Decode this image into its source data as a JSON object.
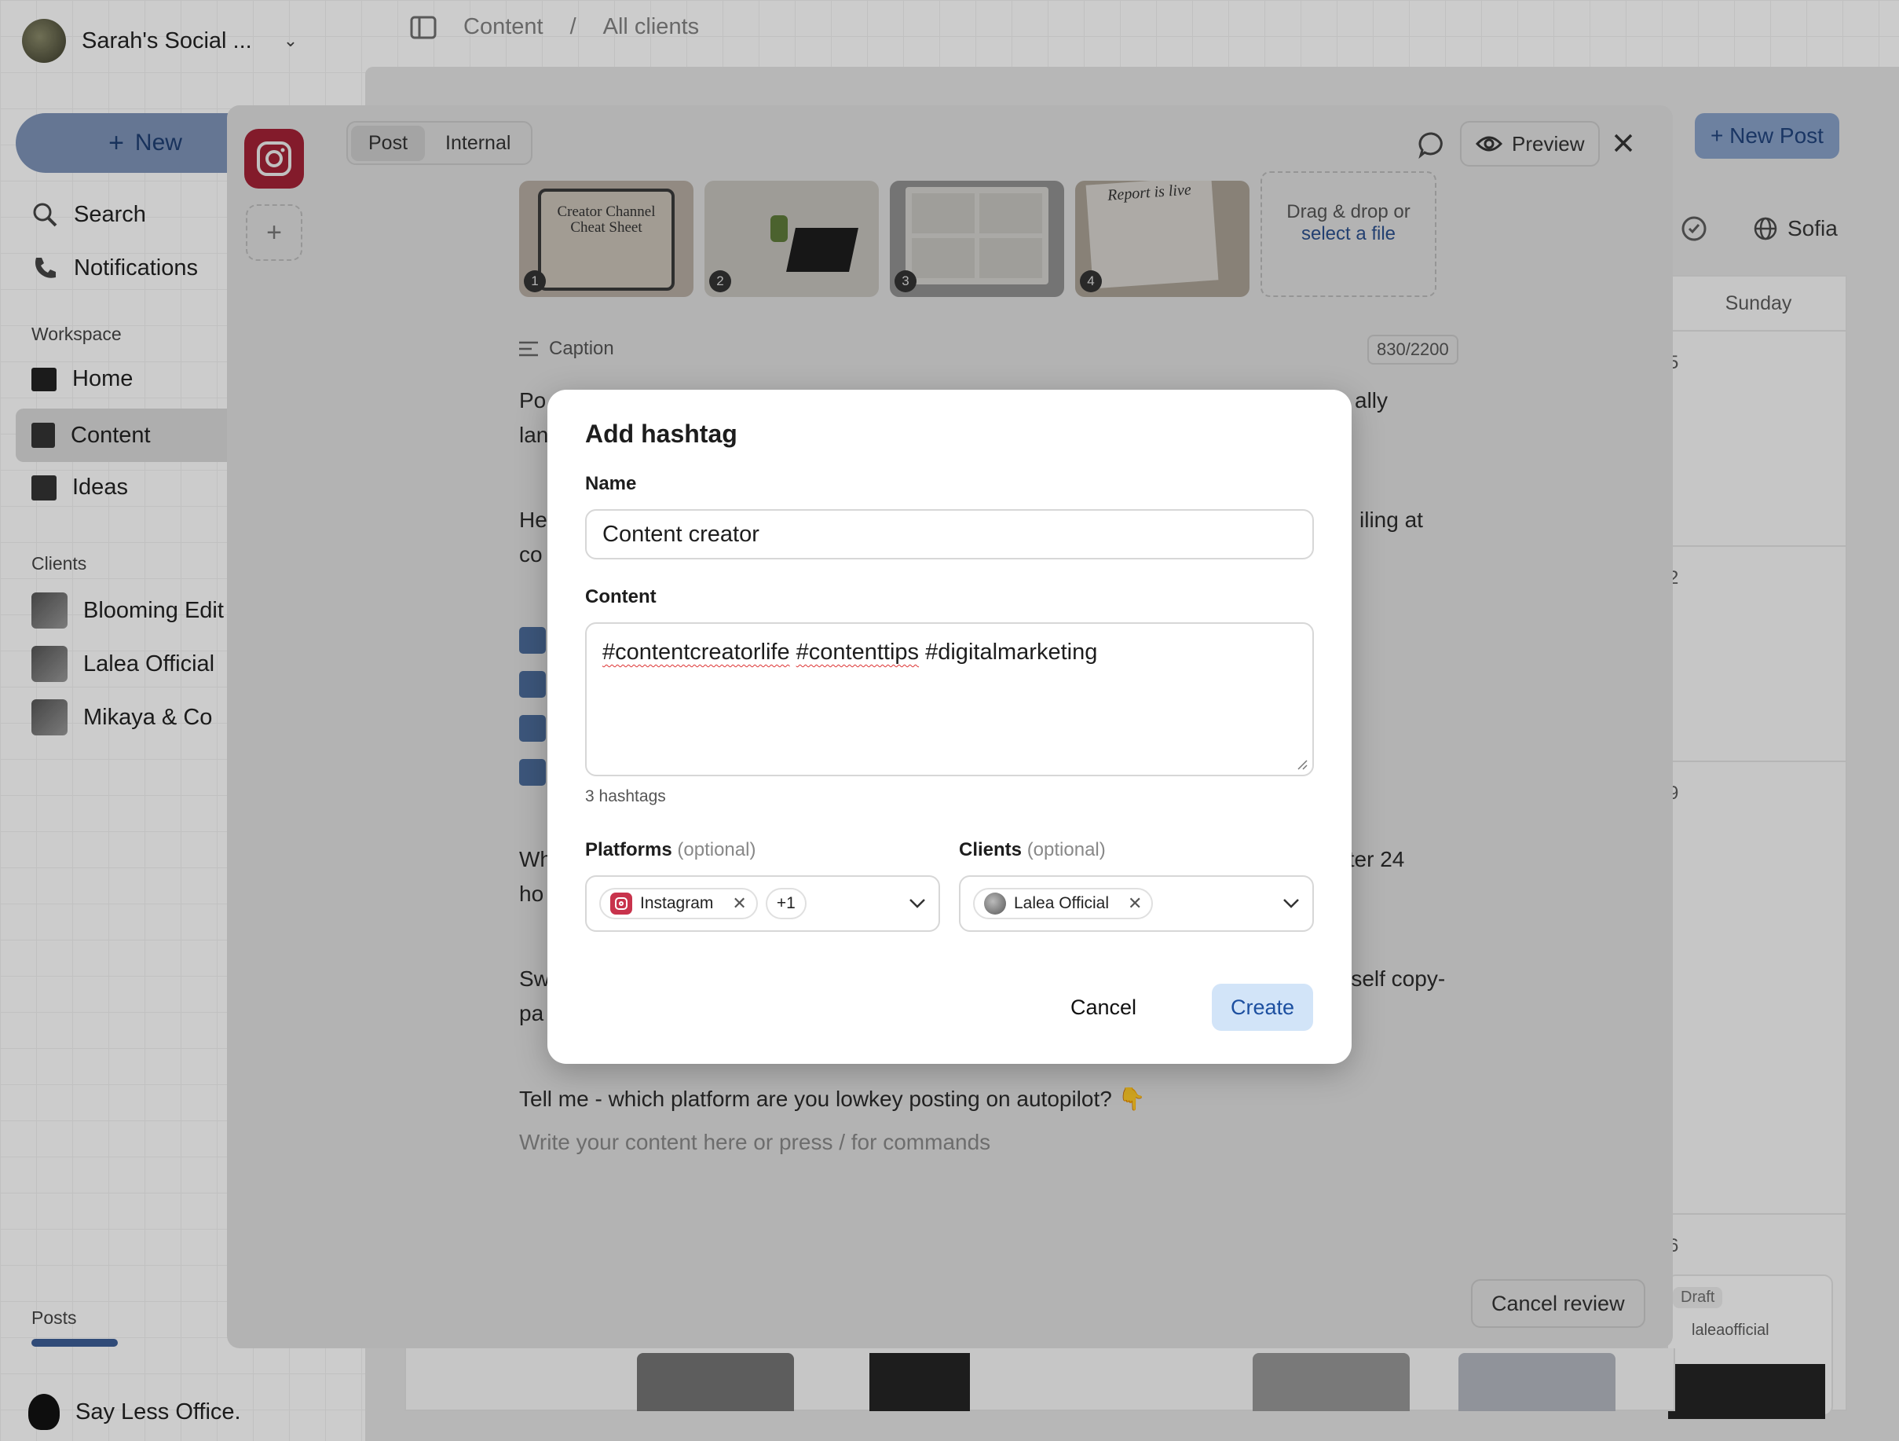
{
  "sidebar": {
    "workspace_name": "Sarah's Social ...",
    "new_label": "New",
    "nav": [
      {
        "label": "Search",
        "icon": "search-icon"
      },
      {
        "label": "Notifications",
        "icon": "phone-icon"
      }
    ],
    "workspace_section": "Workspace",
    "workspace_items": [
      {
        "label": "Home"
      },
      {
        "label": "Content"
      },
      {
        "label": "Ideas"
      }
    ],
    "clients_section": "Clients",
    "clients": [
      {
        "label": "Blooming Edit"
      },
      {
        "label": "Lalea Official"
      },
      {
        "label": "Mikaya & Co"
      }
    ],
    "posts_label": "Posts",
    "footer_name": "Say Less Office."
  },
  "topbar": {
    "crumb1": "Content",
    "crumb2": "All clients",
    "new_post": "+ New Post",
    "user": "Sofia",
    "day": "Sunday"
  },
  "calendar": {
    "dates": [
      "5",
      "2",
      "9",
      "6"
    ],
    "draft_badge": "Draft",
    "draft_account": "laleaofficial"
  },
  "editor": {
    "tabs": [
      {
        "label": "Post",
        "active": true
      },
      {
        "label": "Internal",
        "active": false
      }
    ],
    "preview_label": "Preview",
    "media_numbers": [
      "1",
      "2",
      "3",
      "4"
    ],
    "media_titles": [
      "Creator Channel Cheat Sheet",
      "",
      "",
      "Report is live"
    ],
    "drop_text": "Drag & drop or",
    "drop_link": "select a file",
    "caption_label": "Caption",
    "char_count": "830/2200",
    "lines": [
      {
        "left": "Po",
        "right": "ally"
      },
      {
        "left": "lan",
        "right": ""
      },
      {
        "left": "He",
        "right": "iling at"
      },
      {
        "left": "co",
        "right": ""
      },
      {
        "left": "Wh",
        "right": "fter 24"
      },
      {
        "left": "ho",
        "right": ""
      },
      {
        "left": "Sw",
        "right": "rself copy-"
      },
      {
        "left": "pa",
        "right": ""
      }
    ],
    "question": "Tell me - which platform are you lowkey posting on autopilot? 👇",
    "placeholder": "Write your content here or press / for commands",
    "cancel_review": "Cancel review"
  },
  "modal": {
    "title": "Add hashtag",
    "name_label": "Name",
    "name_value": "Content creator",
    "content_label": "Content",
    "content_tags": [
      "#contentcreatorlife",
      "#contenttips",
      "#digitalmarketing"
    ],
    "hashtag_count": "3 hashtags",
    "platforms_label": "Platforms",
    "platforms_opt": "(optional)",
    "platform_chip": "Instagram",
    "platform_more": "+1",
    "clients_label": "Clients",
    "clients_opt": "(optional)",
    "client_chip": "Lalea Official",
    "cancel": "Cancel",
    "create": "Create"
  }
}
